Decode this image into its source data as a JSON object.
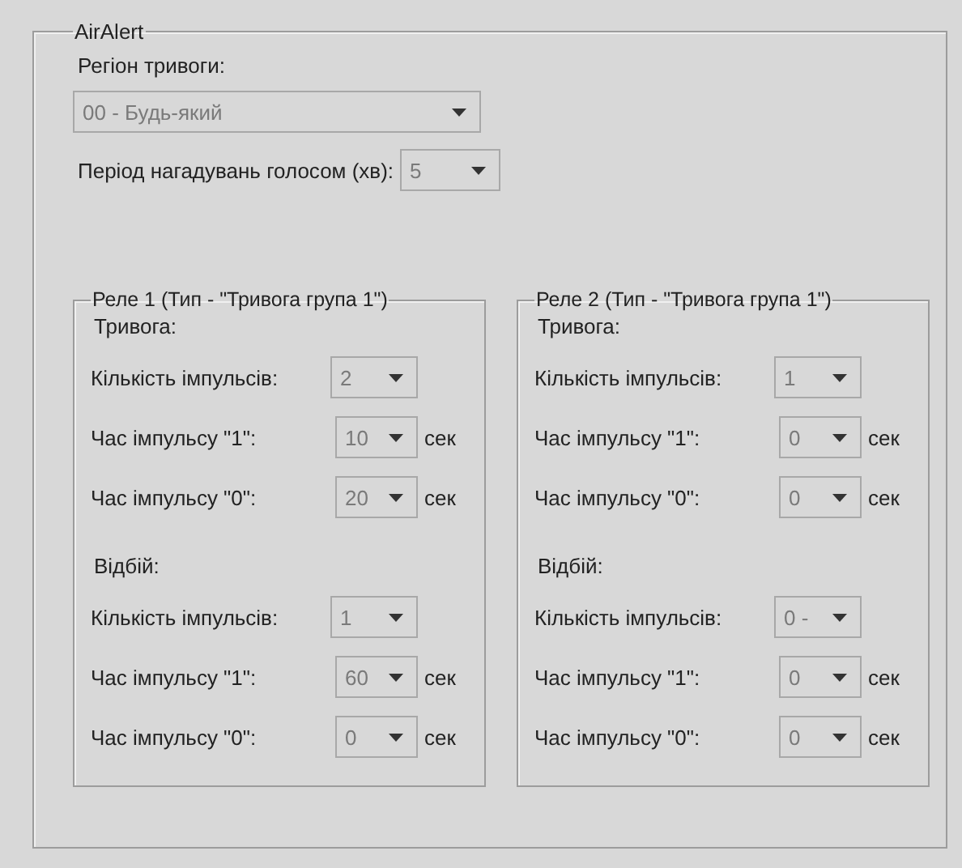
{
  "group": {
    "title": "AirAlert"
  },
  "region": {
    "label": "Регіон тривоги:",
    "value": "00 - Будь-який",
    "disabled": true
  },
  "voice_period": {
    "label": "Період нагадувань голосом (хв):",
    "value": "5",
    "disabled": true
  },
  "relays": [
    {
      "title": "Реле 1 (Тип - \"Тривога група 1\")",
      "sections": [
        {
          "title": "Тривога:",
          "rows": [
            {
              "label": "Кількість імпульсів:",
              "value": "2",
              "disabled": true
            },
            {
              "label": "Час імпульсу \"1\":",
              "value": "10",
              "unit": "сек",
              "disabled": true
            },
            {
              "label": "Час імпульсу \"0\":",
              "value": "20",
              "unit": "сек",
              "disabled": true
            }
          ]
        },
        {
          "title": "Відбій:",
          "rows": [
            {
              "label": "Кількість імпульсів:",
              "value": "1",
              "disabled": true
            },
            {
              "label": "Час імпульсу \"1\":",
              "value": "60",
              "unit": "сек",
              "disabled": true
            },
            {
              "label": "Час імпульсу \"0\":",
              "value": "0",
              "unit": "сек",
              "disabled": true
            }
          ]
        }
      ]
    },
    {
      "title": "Реле 2 (Тип - \"Тривога група 1\")",
      "sections": [
        {
          "title": "Тривога:",
          "rows": [
            {
              "label": "Кількість імпульсів:",
              "value": "1",
              "disabled": true
            },
            {
              "label": "Час імпульсу \"1\":",
              "value": "0",
              "unit": "сек",
              "disabled": true
            },
            {
              "label": "Час імпульсу \"0\":",
              "value": "0",
              "unit": "сек",
              "disabled": true
            }
          ]
        },
        {
          "title": "Відбій:",
          "rows": [
            {
              "label": "Кількість імпульсів:",
              "value": "0 -",
              "disabled": true
            },
            {
              "label": "Час імпульсу \"1\":",
              "value": "0",
              "unit": "сек",
              "disabled": true
            },
            {
              "label": "Час імпульсу \"0\":",
              "value": "0",
              "unit": "сек",
              "disabled": true
            }
          ]
        }
      ]
    }
  ]
}
